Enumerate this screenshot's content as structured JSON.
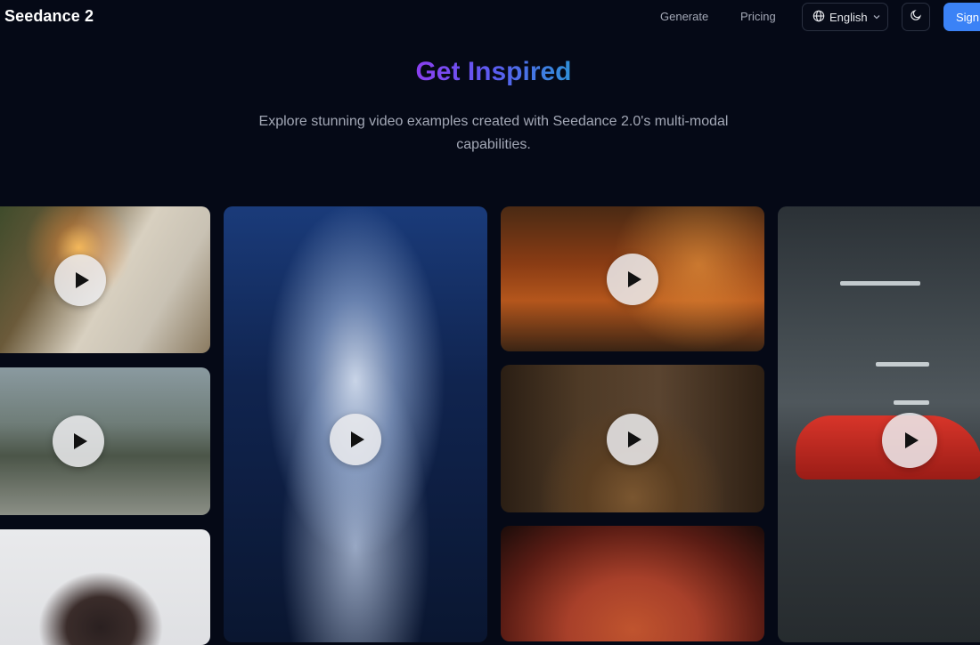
{
  "nav": {
    "brand": "Seedance 2",
    "links": {
      "generate": "Generate",
      "pricing": "Pricing"
    },
    "language": "English",
    "sign_label": "Sign"
  },
  "hero": {
    "title": "Get Inspired",
    "subtitle": "Explore stunning video examples created with Seedance 2.0's multi-modal capabilities."
  },
  "colors": {
    "background": "#050916",
    "accent": "#3b82f6",
    "title_gradient": [
      "#8b3ff0",
      "#5b5cf0",
      "#2f90d8"
    ]
  },
  "icons": {
    "language": "globe-icon",
    "dropdown": "chevron-down-icon",
    "theme": "moon-icon",
    "play": "play-icon"
  },
  "gallery": [
    {
      "name": "video-card-laundry",
      "depicts": "woman hanging laundry on sunlit balcony"
    },
    {
      "name": "video-card-crowd",
      "depicts": "crowd running on city street"
    },
    {
      "name": "video-card-portrait",
      "depicts": "portrait of a woman"
    },
    {
      "name": "video-card-angel",
      "depicts": "angel statue with wings"
    },
    {
      "name": "video-card-forest-duel",
      "depicts": "warriors in autumn forest"
    },
    {
      "name": "video-card-elevator-man",
      "depicts": "man in elevator"
    },
    {
      "name": "video-card-eye",
      "depicts": "close-up red texture"
    },
    {
      "name": "video-card-garage-car",
      "depicts": "red sports car in parking garage"
    }
  ]
}
